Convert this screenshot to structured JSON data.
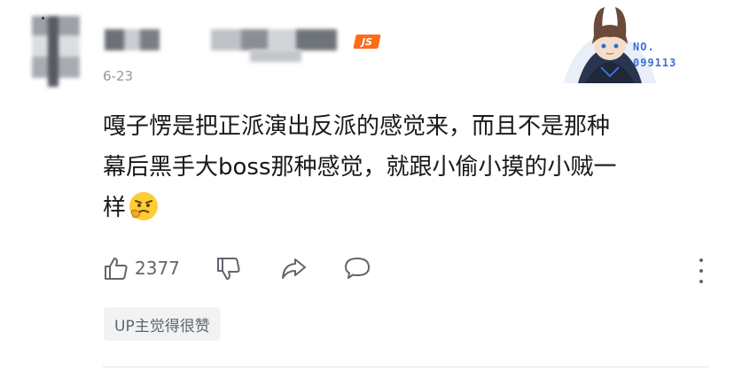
{
  "comment": {
    "level_badge": "JS",
    "date": "6-23",
    "fan_badge": {
      "no_label": "NO.",
      "number": "099113"
    },
    "text_lines": [
      "嘎子愣是把正派演出反派的感觉来，而且不是那种",
      "幕后黑手大boss那种感觉，就跟小偷小摸的小贼一",
      "样"
    ],
    "actions": {
      "like_count": "2377",
      "icons": [
        "thumbs-up-icon",
        "thumbs-down-icon",
        "share-icon",
        "reply-icon",
        "more-icon"
      ]
    },
    "up_tag": "UP主觉得很赞"
  },
  "colors": {
    "accent": "#ff6a16",
    "text": "#18191c",
    "muted": "#9499a0",
    "fan_blue": "#3d6fd6"
  }
}
